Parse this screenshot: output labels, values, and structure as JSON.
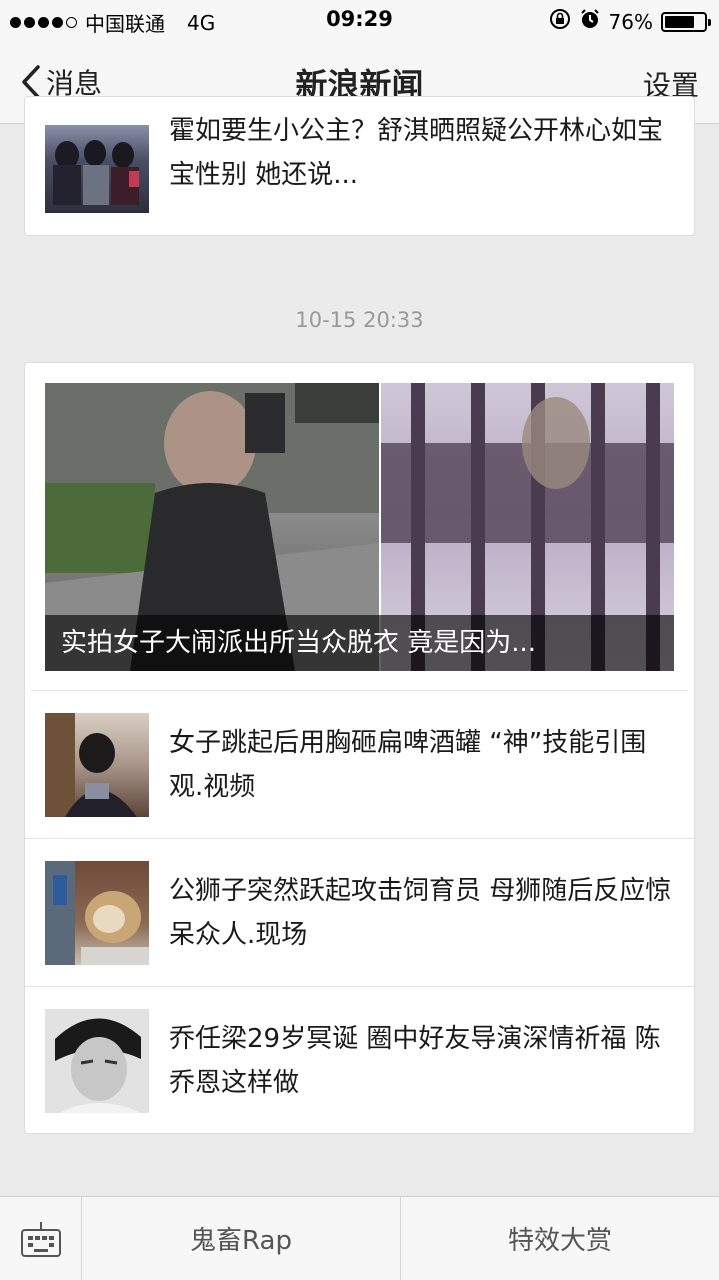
{
  "status_bar": {
    "carrier": "中国联通",
    "network": "4G",
    "time": "09:29",
    "battery": "76%",
    "battery_level": 0.76
  },
  "nav": {
    "back_label": "消息",
    "title": "新浪新闻",
    "settings_label": "设置"
  },
  "top_card": {
    "title": "霍如要生小公主？舒淇晒照疑公开林心如宝宝性别 她还说..."
  },
  "timestamp": "10-15 20:33",
  "main_card": {
    "headline_caption": "实拍女子大闹派出所当众脱衣 竟是因为...",
    "items": [
      {
        "title": "女子跳起后用胸砸扁啤酒罐 “神”技能引围观.视频"
      },
      {
        "title": "公狮子突然跃起攻击饲育员 母狮随后反应惊呆众人.现场"
      },
      {
        "title": "乔任梁29岁冥诞 圈中好友导演深情祈福 陈乔恩这样做"
      }
    ]
  },
  "bottom_bar": {
    "menu_1": "鬼畜Rap",
    "menu_2": "特效大赏"
  }
}
